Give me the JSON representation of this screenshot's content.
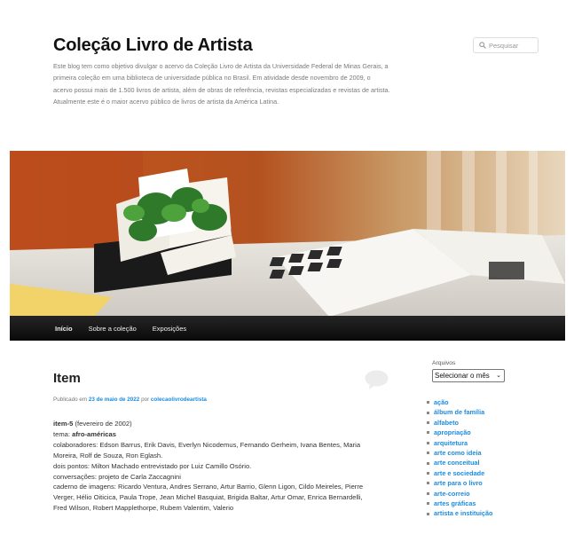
{
  "header": {
    "title": "Coleção Livro de Artista",
    "description": "Este blog tem como objetivo divulgar o acervo da Coleção Livro de Artista da Universidade Federal de Minas Gerais, a primeira coleção em uma biblioteca de universidade pública no Brasil. Em atividade desde novembro de 2009, o acervo possui mais de 1.500 livros de artista, além de obras de referência, revistas especializadas e revistas de artista. Atualmente este é o maior acervo público de livros de artista da América Latina."
  },
  "search": {
    "placeholder": "Pesquisar"
  },
  "nav": {
    "items": [
      {
        "label": "Início"
      },
      {
        "label": "Sobre a coleção"
      },
      {
        "label": "Exposições"
      }
    ]
  },
  "post": {
    "title": "Item",
    "meta_prefix": "Publicado em",
    "date": "23 de maio de 2022",
    "meta_by": "por",
    "author": "colecaolivrodeartista",
    "item_label": "item-5",
    "item_date": "(fevereiro de 2002)",
    "tema_label": "tema:",
    "tema_value": "afro-américas",
    "line_colaboradores": "colaboradores: Edson Barrus, Erik Davis, Everlyn Nicodemus, Fernando Gerheim, Ivana Bentes, Maria Moreira, Rolf de Souza, Ron Eglash.",
    "line_pontos": "dois pontos: Milton Machado entrevistado por Luiz Camillo Osório.",
    "line_conversacoes": "conversações: projeto de Carla Zaccagnini",
    "line_caderno": "caderno de imagens: Ricardo Ventura, Andres Serrano, Artur Barrio, Glenn Ligon, Cildo Meireles, Pierre Verger, Hélio Oiticica, Paula Trope, Jean Michel Basquiat, Brigida Baltar, Artur Omar, Enrica Bernardelli, Fred Wilson, Robert Mapplethorpe, Rubem Valentim, Valerio"
  },
  "sidebar": {
    "archives_label": "Arquivos",
    "month_select_value": "Selecionar o mês",
    "categories": [
      "ação",
      "álbum de família",
      "alfabeto",
      "apropriação",
      "arquitetura",
      "arte como ideia",
      "arte conceitual",
      "arte e sociedade",
      "arte para o livro",
      "arte-correio",
      "artes gráficas",
      "artista e instituição"
    ]
  },
  "colors": {
    "link": "#1b8be0",
    "nav_bg": "#111111",
    "title": "#111111"
  }
}
